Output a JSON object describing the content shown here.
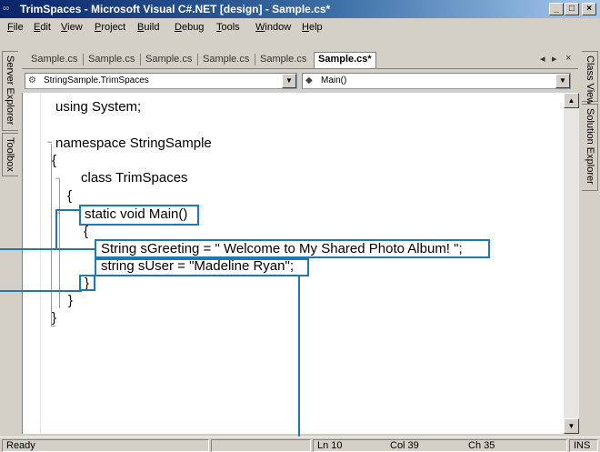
{
  "window": {
    "title": "TrimSpaces - Microsoft Visual C#.NET [design] - Sample.cs*",
    "minimize": "_",
    "maximize": "□",
    "close": "×"
  },
  "menu": [
    {
      "label": "File",
      "key": "F",
      "rest": "ile"
    },
    {
      "label": "Edit",
      "key": "E",
      "rest": "dit"
    },
    {
      "label": "View",
      "key": "V",
      "rest": "iew"
    },
    {
      "label": "Project",
      "key": "P",
      "rest": "roject"
    },
    {
      "label": "Build",
      "key": "B",
      "rest": "uild"
    },
    {
      "label": "Debug",
      "key": "D",
      "rest": "ebug"
    },
    {
      "label": "Tools",
      "key": "T",
      "rest": "ools"
    },
    {
      "label": "Window",
      "key": "W",
      "rest": "indow"
    },
    {
      "label": "Help",
      "key": "H",
      "rest": "elp"
    }
  ],
  "side_tabs_left": [
    "Server Explorer",
    "Toolbox"
  ],
  "side_tabs_right": [
    "Class View",
    "Solution Explorer"
  ],
  "doc_tabs": [
    "Sample.cs",
    "Sample.cs",
    "Sample.cs",
    "Sample.cs",
    "Sample.cs",
    "Sample.cs*"
  ],
  "tab_controls": {
    "left": "◂",
    "right": "▸",
    "close": "×"
  },
  "nav": {
    "class_combo": "StringSample.TrimSpaces",
    "member_combo": "Main()",
    "dropdown_arrow": "▼"
  },
  "code": {
    "using_line": "using System;",
    "namespace_line": "namespace StringSample",
    "open_brace_1": "{",
    "class_line": "class TrimSpaces",
    "open_brace_2": "{",
    "method_line": "static void Main()",
    "open_brace_3": "{",
    "greeting_line": "String sGreeting = \" Welcome to My Shared Photo Album! \";",
    "user_line": "string sUser = \"Madeline Ryan\";",
    "close_brace_3": "}",
    "close_brace_2": "}",
    "close_brace_1": "}",
    "collapse_marker": "−"
  },
  "scrollbar": {
    "up": "▲",
    "down": "▼"
  },
  "status": {
    "ready": "Ready",
    "line": "Ln 10",
    "col": "Col 39",
    "ch": "Ch 35",
    "ins": "INS"
  },
  "colors": {
    "callout": "#1f77b4",
    "titlebar_start": "#0a246a"
  }
}
